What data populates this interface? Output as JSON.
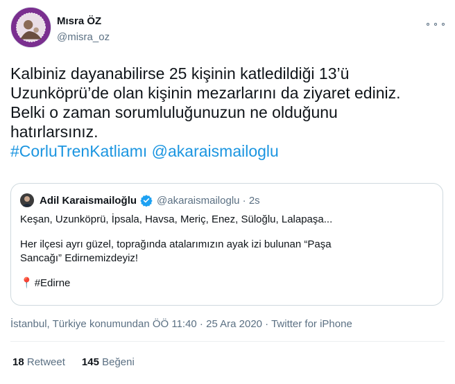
{
  "author": {
    "name": "Mısra ÖZ",
    "handle": "@misra_oz",
    "avatar_color": "#7a2f8f"
  },
  "tweet": {
    "lines": [
      "Kalbiniz dayanabilirse 25 kişinin katledildiği 13’ü",
      "Uzunköprü’de olan kişinin mezarlarını da ziyaret ediniz.",
      "Belki o zaman sorumluluğunuzun ne olduğunu",
      "hatırlarsınız."
    ],
    "hashtag": "#CorluTrenKatliamı",
    "mention": "@akaraismailoglu",
    "link_color": "#1b95e0"
  },
  "quoted": {
    "name": "Adil Karaismailoğlu",
    "handle_time": "@akaraismailoglu · 2s",
    "line1": "Keşan, Uzunköprü, İpsala, Havsa, Meriç, Enez, Süloğlu, Lalapaşa...",
    "line2": "Her ilçesi ayrı güzel, toprağında atalarımızın ayak izi bulunan “Paşa",
    "line3": "Sancağı” Edirnemizdeyiz!",
    "pin": "📍",
    "hashtag": "#Edirne",
    "verified_color": "#1da1f2"
  },
  "meta": {
    "location_time": "İstanbul, Türkiye konumundan ÖÖ 11:40 · 25 Ara 2020 · ",
    "client": "Twitter for iPhone"
  },
  "stats": {
    "retweets": "18",
    "retweets_label": "Retweet",
    "likes": "145",
    "likes_label": "Beğeni"
  }
}
